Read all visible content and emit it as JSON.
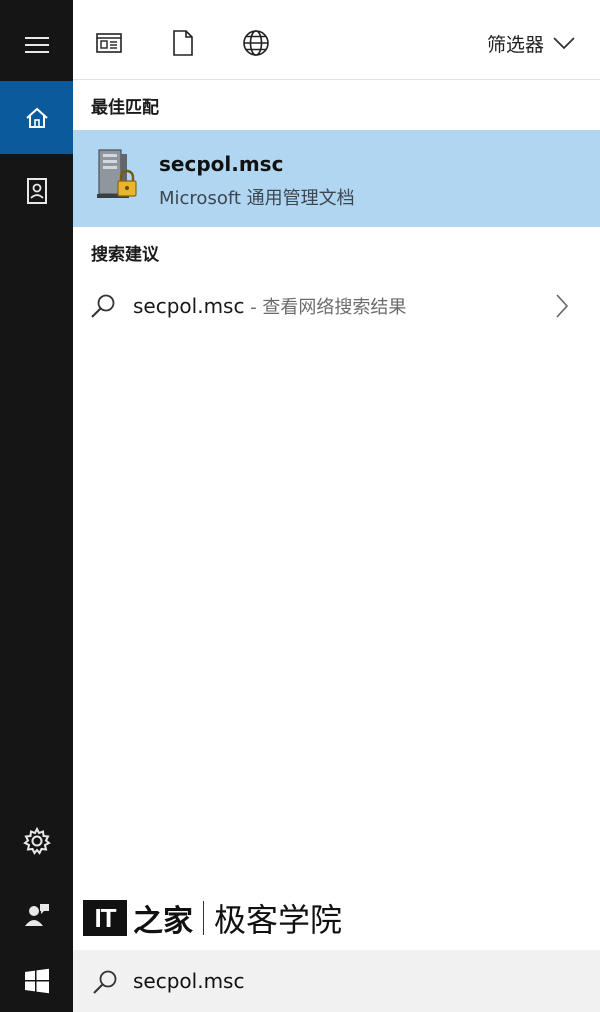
{
  "sidebar": {
    "items": [
      {
        "icon": "hamburger-menu-icon"
      },
      {
        "icon": "home-icon",
        "active": true
      },
      {
        "icon": "notebook-icon"
      },
      {
        "icon": "settings-gear-icon"
      },
      {
        "icon": "user-feedback-icon"
      },
      {
        "icon": "windows-start-icon"
      }
    ],
    "active_color": "#0b5a9c",
    "background": "#151515"
  },
  "topbar": {
    "tabs": [
      {
        "icon": "apps-window-icon"
      },
      {
        "icon": "document-icon"
      },
      {
        "icon": "web-globe-icon"
      }
    ],
    "filter_label": "筛选器"
  },
  "best_match": {
    "heading": "最佳匹配",
    "title": "secpol.msc",
    "subtitle": "Microsoft 通用管理文档",
    "icon": "secpol-server-lock-icon",
    "highlight_color": "#b1d6f2"
  },
  "suggestions": {
    "heading": "搜索建议",
    "items": [
      {
        "query": "secpol.msc",
        "hint": " - 查看网络搜索结果"
      }
    ]
  },
  "watermark": {
    "logo_text": "IT",
    "glyph": "之家",
    "text": "极客学院"
  },
  "search": {
    "value": "secpol.msc"
  }
}
